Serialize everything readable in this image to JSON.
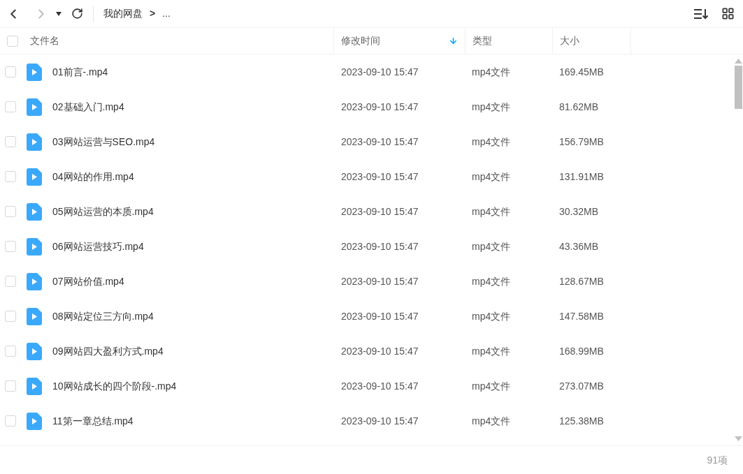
{
  "toolbar": {
    "breadcrumb": [
      "我的网盘",
      "..."
    ],
    "separator": ">"
  },
  "table": {
    "select_all": {
      "checked": false
    },
    "columns": [
      {
        "label": "文件名",
        "sorted": false
      },
      {
        "label": "修改时间",
        "sorted": true
      },
      {
        "label": "类型",
        "sorted": false
      },
      {
        "label": "大小",
        "sorted": false
      }
    ],
    "rows": [
      {
        "name": "01前言-.mp4",
        "modified": "2023-09-10 15:47",
        "type": "mp4文件",
        "size": "169.45MB",
        "checked": false
      },
      {
        "name": "02基础入门.mp4",
        "modified": "2023-09-10 15:47",
        "type": "mp4文件",
        "size": "81.62MB",
        "checked": false
      },
      {
        "name": "03网站运营与SEO.mp4",
        "modified": "2023-09-10 15:47",
        "type": "mp4文件",
        "size": "156.79MB",
        "checked": false
      },
      {
        "name": "04网站的作用.mp4",
        "modified": "2023-09-10 15:47",
        "type": "mp4文件",
        "size": "131.91MB",
        "checked": false
      },
      {
        "name": "05网站运营的本质.mp4",
        "modified": "2023-09-10 15:47",
        "type": "mp4文件",
        "size": "30.32MB",
        "checked": false
      },
      {
        "name": "06网站运营技巧.mp4",
        "modified": "2023-09-10 15:47",
        "type": "mp4文件",
        "size": "43.36MB",
        "checked": false
      },
      {
        "name": "07网站价值.mp4",
        "modified": "2023-09-10 15:47",
        "type": "mp4文件",
        "size": "128.67MB",
        "checked": false
      },
      {
        "name": "08网站定位三方向.mp4",
        "modified": "2023-09-10 15:47",
        "type": "mp4文件",
        "size": "147.58MB",
        "checked": false
      },
      {
        "name": "09网站四大盈利方式.mp4",
        "modified": "2023-09-10 15:47",
        "type": "mp4文件",
        "size": "168.99MB",
        "checked": false
      },
      {
        "name": "10网站成长的四个阶段-.mp4",
        "modified": "2023-09-10 15:47",
        "type": "mp4文件",
        "size": "273.07MB",
        "checked": false
      },
      {
        "name": "11第一章总结.mp4",
        "modified": "2023-09-10 15:47",
        "type": "mp4文件",
        "size": "125.38MB",
        "checked": false
      }
    ]
  },
  "status_bar": {
    "count": "91项"
  }
}
